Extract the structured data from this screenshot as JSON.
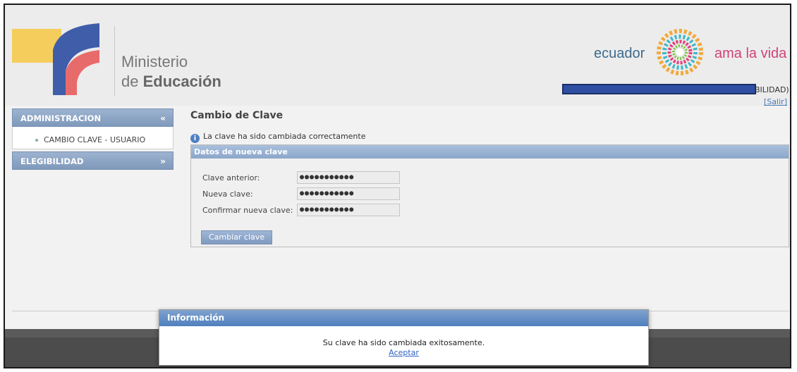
{
  "header": {
    "ministry_line1": "Ministerio",
    "ministry_line2_prefix": "de",
    "ministry_line2_bold": "Educación",
    "slogan_left": "ecuador",
    "slogan_right": "ama la vida",
    "user_suffix": "BILIDAD)",
    "logout_label": "[Salir]"
  },
  "sidebar": {
    "sections": [
      {
        "label": "ADMINISTRACION",
        "chevron": "«",
        "items": [
          {
            "label": "CAMBIO CLAVE - USUARIO"
          }
        ]
      },
      {
        "label": "ELEGIBILIDAD",
        "chevron": "»"
      }
    ]
  },
  "main": {
    "title": "Cambio de Clave",
    "info_message": "La clave ha sido cambiada correctamente",
    "panel_title": "Datos de nueva clave",
    "fields": [
      {
        "label": "Clave anterior:",
        "value": "●●●●●●●●●●●"
      },
      {
        "label": "Nueva clave:",
        "value": "●●●●●●●●●●●"
      },
      {
        "label": "Confirmar nueva clave:",
        "value": "●●●●●●●●●●●"
      }
    ],
    "submit_label": "Cambiar clave"
  },
  "dialog": {
    "title": "Información",
    "message": "Su clave ha sido cambiada exitosamente.",
    "ok_label": "Aceptar"
  },
  "colors": {
    "accent_blue": "#7f99bb",
    "dialog_header": "#4f7fbd",
    "slogan_blue": "#3d6b8e",
    "slogan_pink": "#d0427a"
  },
  "icons": [
    "ministry-logo",
    "info-icon",
    "chevron-up-icon",
    "chevron-down-icon",
    "sun-logo"
  ]
}
